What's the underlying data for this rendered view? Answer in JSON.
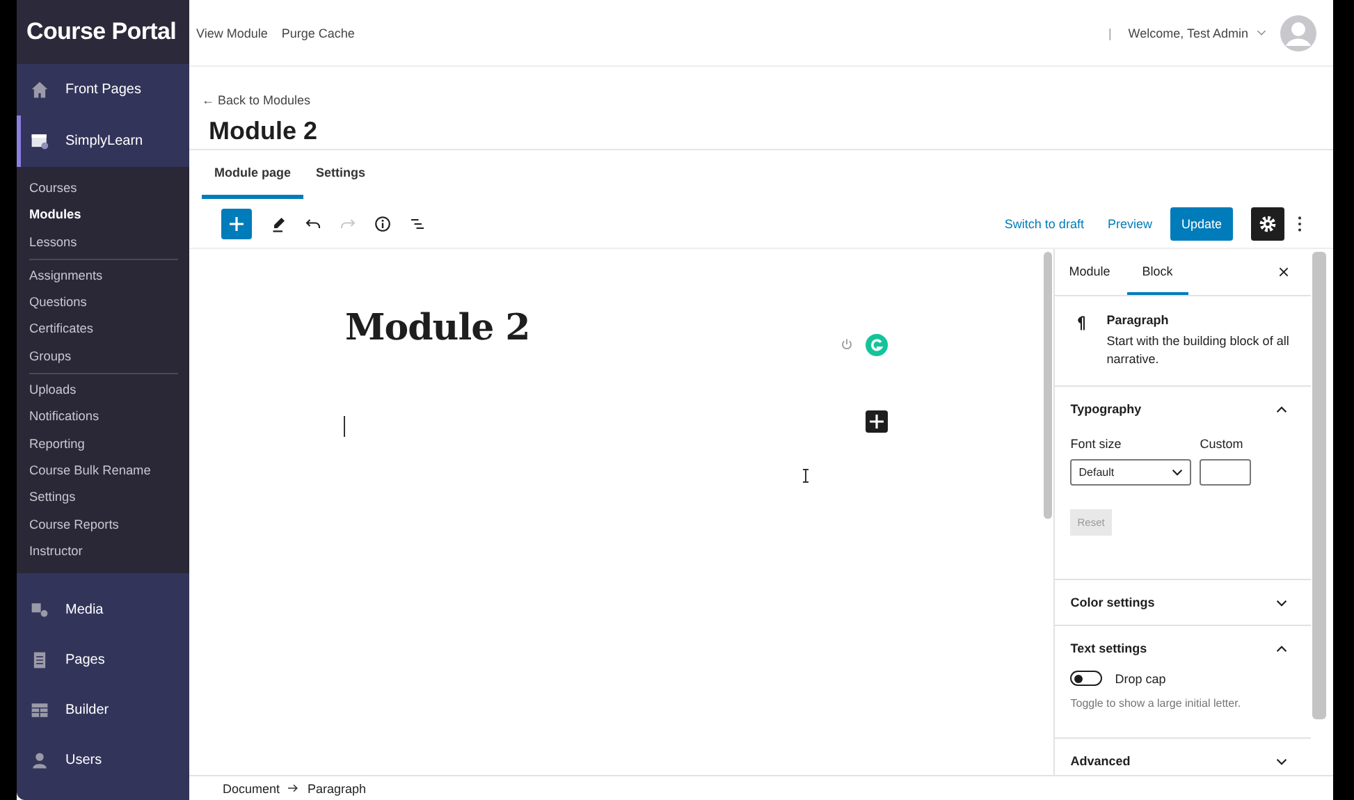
{
  "sidebar": {
    "brand": "Course Portal",
    "top_items": [
      {
        "label": "Front Pages",
        "selected": false
      },
      {
        "label": "SimplyLearn",
        "selected": true
      }
    ],
    "submenu": [
      [
        {
          "label": "Courses",
          "selected": false
        },
        {
          "label": "Modules",
          "selected": true
        },
        {
          "label": "Lessons",
          "selected": false
        }
      ],
      [
        {
          "label": "Assignments",
          "selected": false
        },
        {
          "label": "Questions",
          "selected": false
        },
        {
          "label": "Certificates",
          "selected": false
        },
        {
          "label": "Groups",
          "selected": false
        }
      ],
      [
        {
          "label": "Uploads",
          "selected": false
        },
        {
          "label": "Notifications",
          "selected": false
        },
        {
          "label": "Reporting",
          "selected": false
        },
        {
          "label": "Course Bulk Rename",
          "selected": false
        },
        {
          "label": "Settings",
          "selected": false
        },
        {
          "label": "Course Reports",
          "selected": false
        },
        {
          "label": "Instructor",
          "selected": false
        }
      ]
    ],
    "bottom_items": [
      {
        "label": "Media"
      },
      {
        "label": "Pages"
      },
      {
        "label": "Builder"
      },
      {
        "label": "Users"
      }
    ]
  },
  "topbar": {
    "links": [
      "View Module",
      "Purge Cache"
    ],
    "separator": "|",
    "welcome": "Welcome, Test Admin"
  },
  "header": {
    "back_link": "← Back to Modules",
    "title": "Module 2"
  },
  "tabs": [
    {
      "label": "Module page",
      "selected": true
    },
    {
      "label": "Settings",
      "selected": false
    }
  ],
  "toolbar": {
    "redo_disabled": true,
    "switch_to_draft": "Switch to draft",
    "preview": "Preview",
    "update": "Update",
    "settings_on": true
  },
  "editor": {
    "title": "Module 2"
  },
  "panel": {
    "tabs": [
      {
        "label": "Module",
        "selected": false
      },
      {
        "label": "Block",
        "selected": true
      }
    ],
    "block": {
      "name": "Paragraph",
      "description": "Start with the building block of all narrative."
    },
    "sections": [
      {
        "kind": "typography",
        "title": "Typography",
        "expanded": true,
        "font_size_label": "Font size",
        "font_size_value": "Default",
        "custom_label": "Custom",
        "reset": "Reset",
        "reset_disabled": true
      },
      {
        "title": "Color settings",
        "expanded": false
      },
      {
        "kind": "toggle",
        "title": "Text settings",
        "expanded": true,
        "toggle_label": "Drop cap",
        "on": false,
        "help": "Toggle to show a large initial letter."
      },
      {
        "title": "Advanced",
        "expanded": false
      }
    ]
  },
  "breadcrumb": [
    "Document",
    "Paragraph"
  ]
}
